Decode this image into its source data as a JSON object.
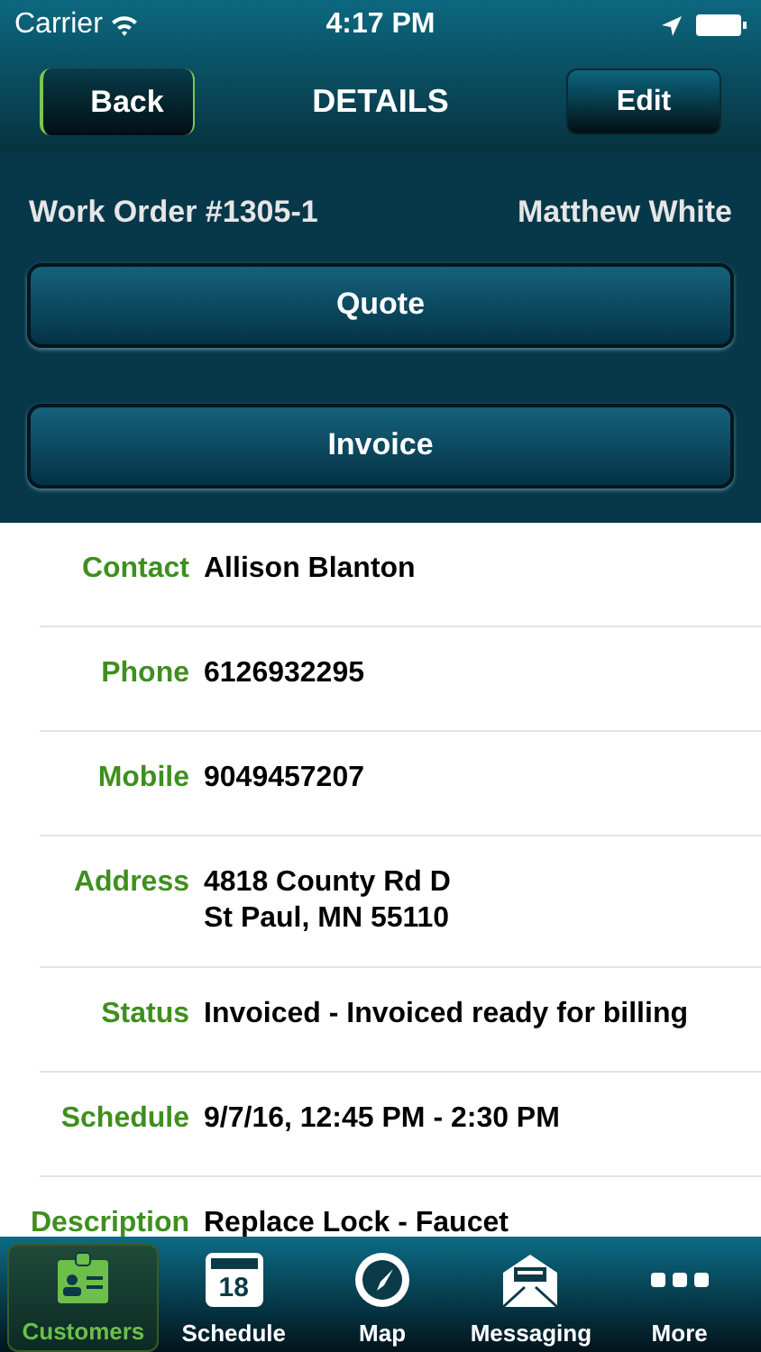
{
  "status_bar": {
    "carrier": "Carrier",
    "time": "4:17 PM"
  },
  "nav": {
    "back": "Back",
    "title": "DETAILS",
    "edit": "Edit"
  },
  "header": {
    "work_order": "Work Order #1305-1",
    "technician": "Matthew White"
  },
  "actions": [
    "Quote",
    "Invoice"
  ],
  "fields": [
    {
      "label": "Contact",
      "value": [
        "Allison Blanton"
      ]
    },
    {
      "label": "Phone",
      "value": [
        "6126932295"
      ]
    },
    {
      "label": "Mobile",
      "value": [
        "9049457207"
      ]
    },
    {
      "label": "Address",
      "value": [
        "4818 County Rd D",
        "St Paul, MN 55110"
      ]
    },
    {
      "label": "Status",
      "value": [
        "Invoiced - Invoiced  ready for billing"
      ]
    },
    {
      "label": "Schedule",
      "value": [
        "9/7/16, 12:45 PM - 2:30 PM"
      ]
    },
    {
      "label": "Description",
      "value": [
        "Replace Lock - Faucet"
      ]
    }
  ],
  "tabs": [
    {
      "label": "Customers",
      "kind": "customers",
      "selected": true
    },
    {
      "label": "Schedule",
      "kind": "calendar",
      "selected": false,
      "day": "18"
    },
    {
      "label": "Map",
      "kind": "compass",
      "selected": false
    },
    {
      "label": "Messaging",
      "kind": "envelope",
      "selected": false
    },
    {
      "label": "More",
      "kind": "dots",
      "selected": false
    }
  ]
}
